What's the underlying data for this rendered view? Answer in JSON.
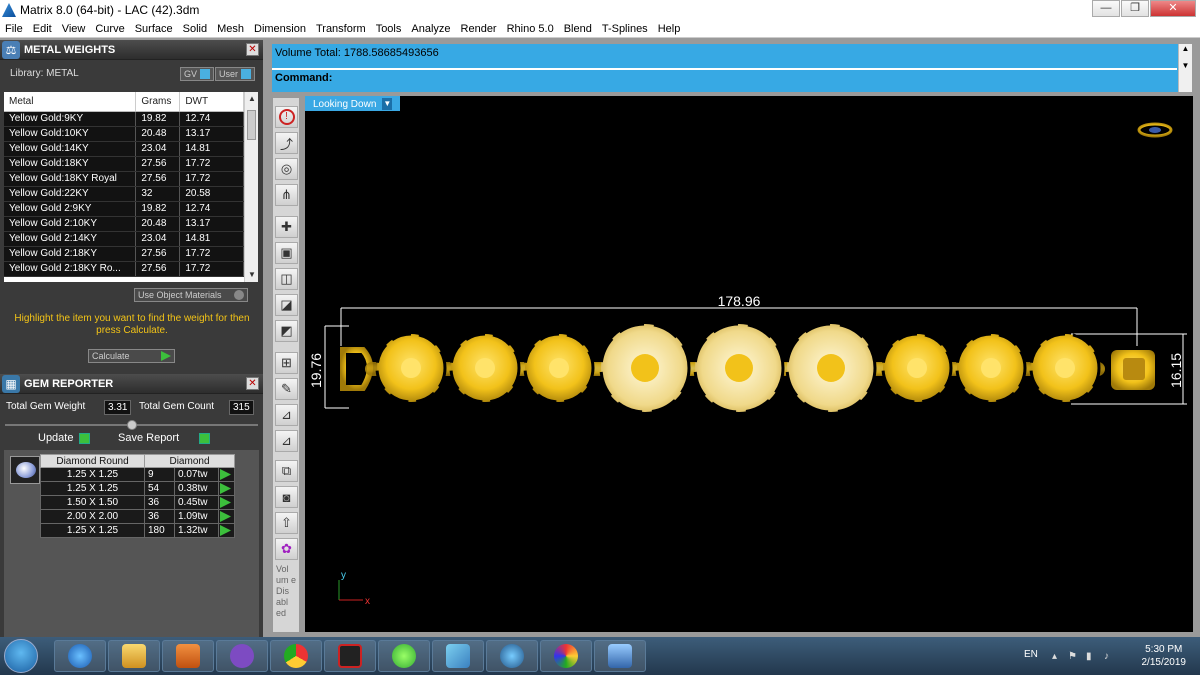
{
  "window": {
    "title": "Matrix 8.0 (64-bit) - LAC (42).3dm",
    "minimize": "—",
    "restore": "❐",
    "close": "✕"
  },
  "menu": [
    "File",
    "Edit",
    "View",
    "Curve",
    "Surface",
    "Solid",
    "Mesh",
    "Dimension",
    "Transform",
    "Tools",
    "Analyze",
    "Render",
    "Rhino 5.0",
    "Blend",
    "T-Splines",
    "Help"
  ],
  "metal_weights": {
    "title": "METAL WEIGHTS",
    "library_label": "Library: METAL",
    "gv_label": "GV",
    "user_label": "User",
    "columns": [
      "Metal",
      "Grams",
      "DWT"
    ],
    "rows": [
      [
        "Yellow Gold:9KY",
        "19.82",
        "12.74"
      ],
      [
        "Yellow Gold:10KY",
        "20.48",
        "13.17"
      ],
      [
        "Yellow Gold:14KY",
        "23.04",
        "14.81"
      ],
      [
        "Yellow Gold:18KY",
        "27.56",
        "17.72"
      ],
      [
        "Yellow Gold:18KY Royal",
        "27.56",
        "17.72"
      ],
      [
        "Yellow Gold:22KY",
        "32",
        "20.58"
      ],
      [
        "Yellow Gold 2:9KY",
        "19.82",
        "12.74"
      ],
      [
        "Yellow Gold 2:10KY",
        "20.48",
        "13.17"
      ],
      [
        "Yellow Gold 2:14KY",
        "23.04",
        "14.81"
      ],
      [
        "Yellow Gold 2:18KY",
        "27.56",
        "17.72"
      ],
      [
        "Yellow Gold 2:18KY Ro...",
        "27.56",
        "17.72"
      ]
    ],
    "use_object_materials": "Use Object Materials",
    "hint": "Highlight the item you want to find the weight for then press Calculate.",
    "calculate": "Calculate"
  },
  "gem_reporter": {
    "title": "GEM REPORTER",
    "total_weight_label": "Total Gem Weight",
    "total_weight": "3.31",
    "total_count_label": "Total Gem Count",
    "total_count": "315",
    "update": "Update",
    "save_report": "Save Report",
    "header_shape": "Diamond Round",
    "header_type": "Diamond",
    "rows": [
      [
        "1.25 X 1.25",
        "9",
        "0.07tw"
      ],
      [
        "1.25 X 1.25",
        "54",
        "0.38tw"
      ],
      [
        "1.50 X 1.50",
        "36",
        "0.45tw"
      ],
      [
        "2.00 X 2.00",
        "36",
        "1.09tw"
      ],
      [
        "1.25 X 1.25",
        "180",
        "1.32tw"
      ]
    ]
  },
  "command": {
    "volume": "Volume Total: 1788.58685493656",
    "prompt": "Command:"
  },
  "toolbar": {
    "vertical_text": "Vol um e Dis abl ed"
  },
  "viewport": {
    "label": "Looking Down",
    "dim_width": "178.96",
    "dim_left_height": "19.76",
    "dim_right_height": "16.15",
    "axis_y": "y",
    "axis_x": "x"
  },
  "taskbar": {
    "lang": "EN",
    "time": "5:30 PM",
    "date": "2/15/2019"
  },
  "colors": {
    "accent": "#37a9e4",
    "gold": "#f2c21a",
    "panel_dark": "#3a3a3a",
    "hint_yellow": "#f3c417"
  }
}
